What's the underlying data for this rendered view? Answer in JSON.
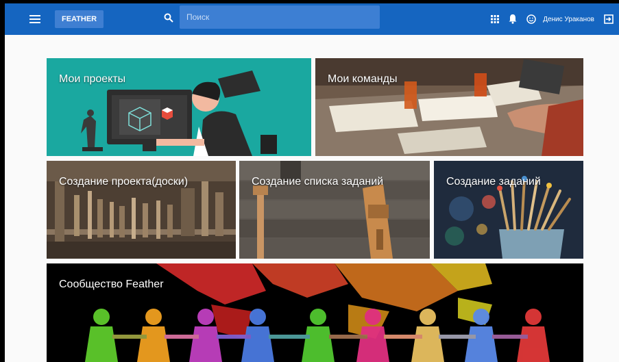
{
  "header": {
    "brand": "FEATHER",
    "search_placeholder": "Поиск",
    "user_name": "Денис Ураканов",
    "icons": [
      "menu-icon",
      "search-icon",
      "apps-icon",
      "bell-icon",
      "smiley-icon",
      "logout-icon"
    ]
  },
  "tiles": [
    {
      "label": "Мои проекты"
    },
    {
      "label": "Мои команды"
    },
    {
      "label": "Создание проекта(доски)"
    },
    {
      "label": "Создание списка заданий"
    },
    {
      "label": "Создание заданий"
    },
    {
      "label": "Сообщество Feather"
    }
  ],
  "colors": {
    "topbar": "#1565c0",
    "projects_tile": "#1aa8a0",
    "community_bg": "#000000"
  }
}
